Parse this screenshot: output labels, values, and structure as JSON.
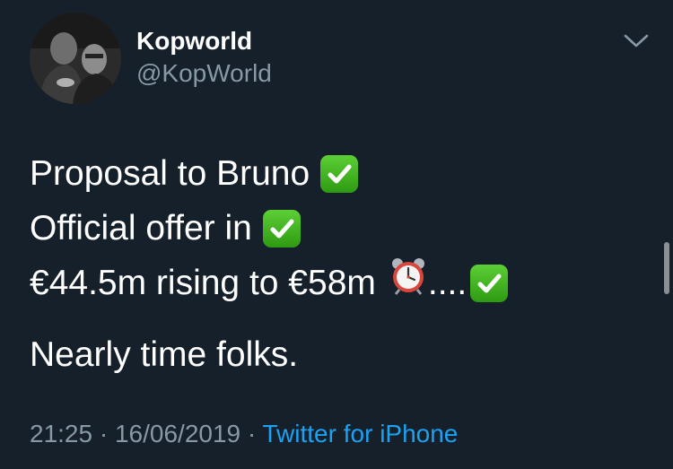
{
  "author": {
    "display_name": "Kopworld",
    "handle": "@KopWorld"
  },
  "tweet": {
    "lines": [
      "Proposal to Bruno",
      "Official offer in",
      "€44.5m rising to €58m",
      "...."
    ],
    "paragraph2": "Nearly time folks.",
    "icons": [
      "white-check-mark-icon",
      "alarm-clock-icon"
    ]
  },
  "meta": {
    "time": "21:25",
    "separator1": " · ",
    "date": "16/06/2019",
    "separator2": " · ",
    "source": "Twitter for iPhone"
  },
  "colors": {
    "background": "#15202b",
    "text": "#ffffff",
    "secondary": "#8899a6",
    "link": "#1da1f2",
    "check": "#3fb31e"
  }
}
